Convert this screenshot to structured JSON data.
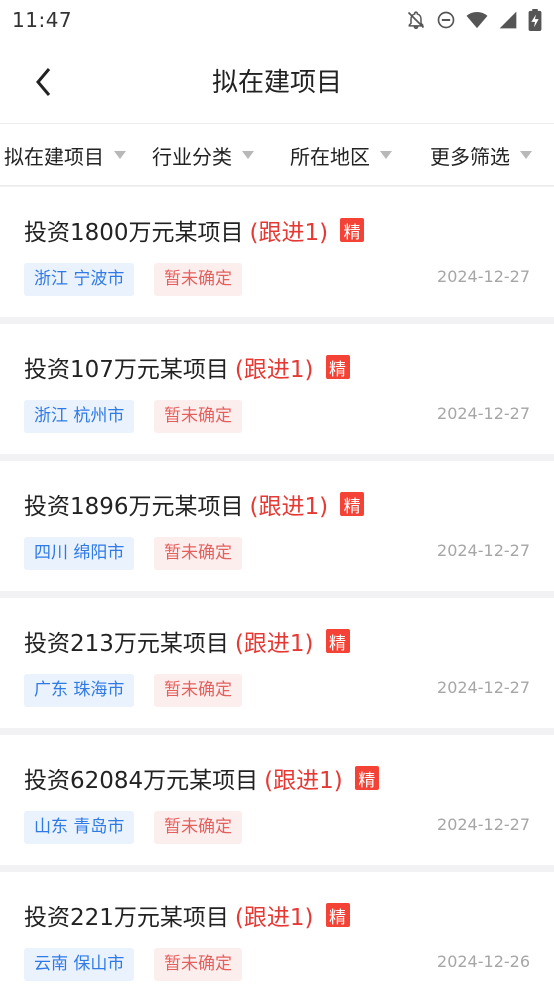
{
  "status_bar": {
    "time": "11:47"
  },
  "header": {
    "title": "拟在建项目"
  },
  "filters": [
    {
      "label": "拟在建项目"
    },
    {
      "label": "行业分类"
    },
    {
      "label": "所在地区"
    },
    {
      "label": "更多筛选"
    }
  ],
  "projects": [
    {
      "title": "投资1800万元某项目",
      "follow": "(跟进1)",
      "badge": "精",
      "region": "浙江 宁波市",
      "status": "暂未确定",
      "date": "2024-12-27"
    },
    {
      "title": "投资107万元某项目",
      "follow": "(跟进1)",
      "badge": "精",
      "region": "浙江 杭州市",
      "status": "暂未确定",
      "date": "2024-12-27"
    },
    {
      "title": "投资1896万元某项目",
      "follow": "(跟进1)",
      "badge": "精",
      "region": "四川 绵阳市",
      "status": "暂未确定",
      "date": "2024-12-27"
    },
    {
      "title": "投资213万元某项目",
      "follow": "(跟进1)",
      "badge": "精",
      "region": "广东 珠海市",
      "status": "暂未确定",
      "date": "2024-12-27"
    },
    {
      "title": "投资62084万元某项目",
      "follow": "(跟进1)",
      "badge": "精",
      "region": "山东 青岛市",
      "status": "暂未确定",
      "date": "2024-12-27"
    },
    {
      "title": "投资221万元某项目",
      "follow": "(跟进1)",
      "badge": "精",
      "region": "云南 保山市",
      "status": "暂未确定",
      "date": "2024-12-26"
    }
  ]
}
